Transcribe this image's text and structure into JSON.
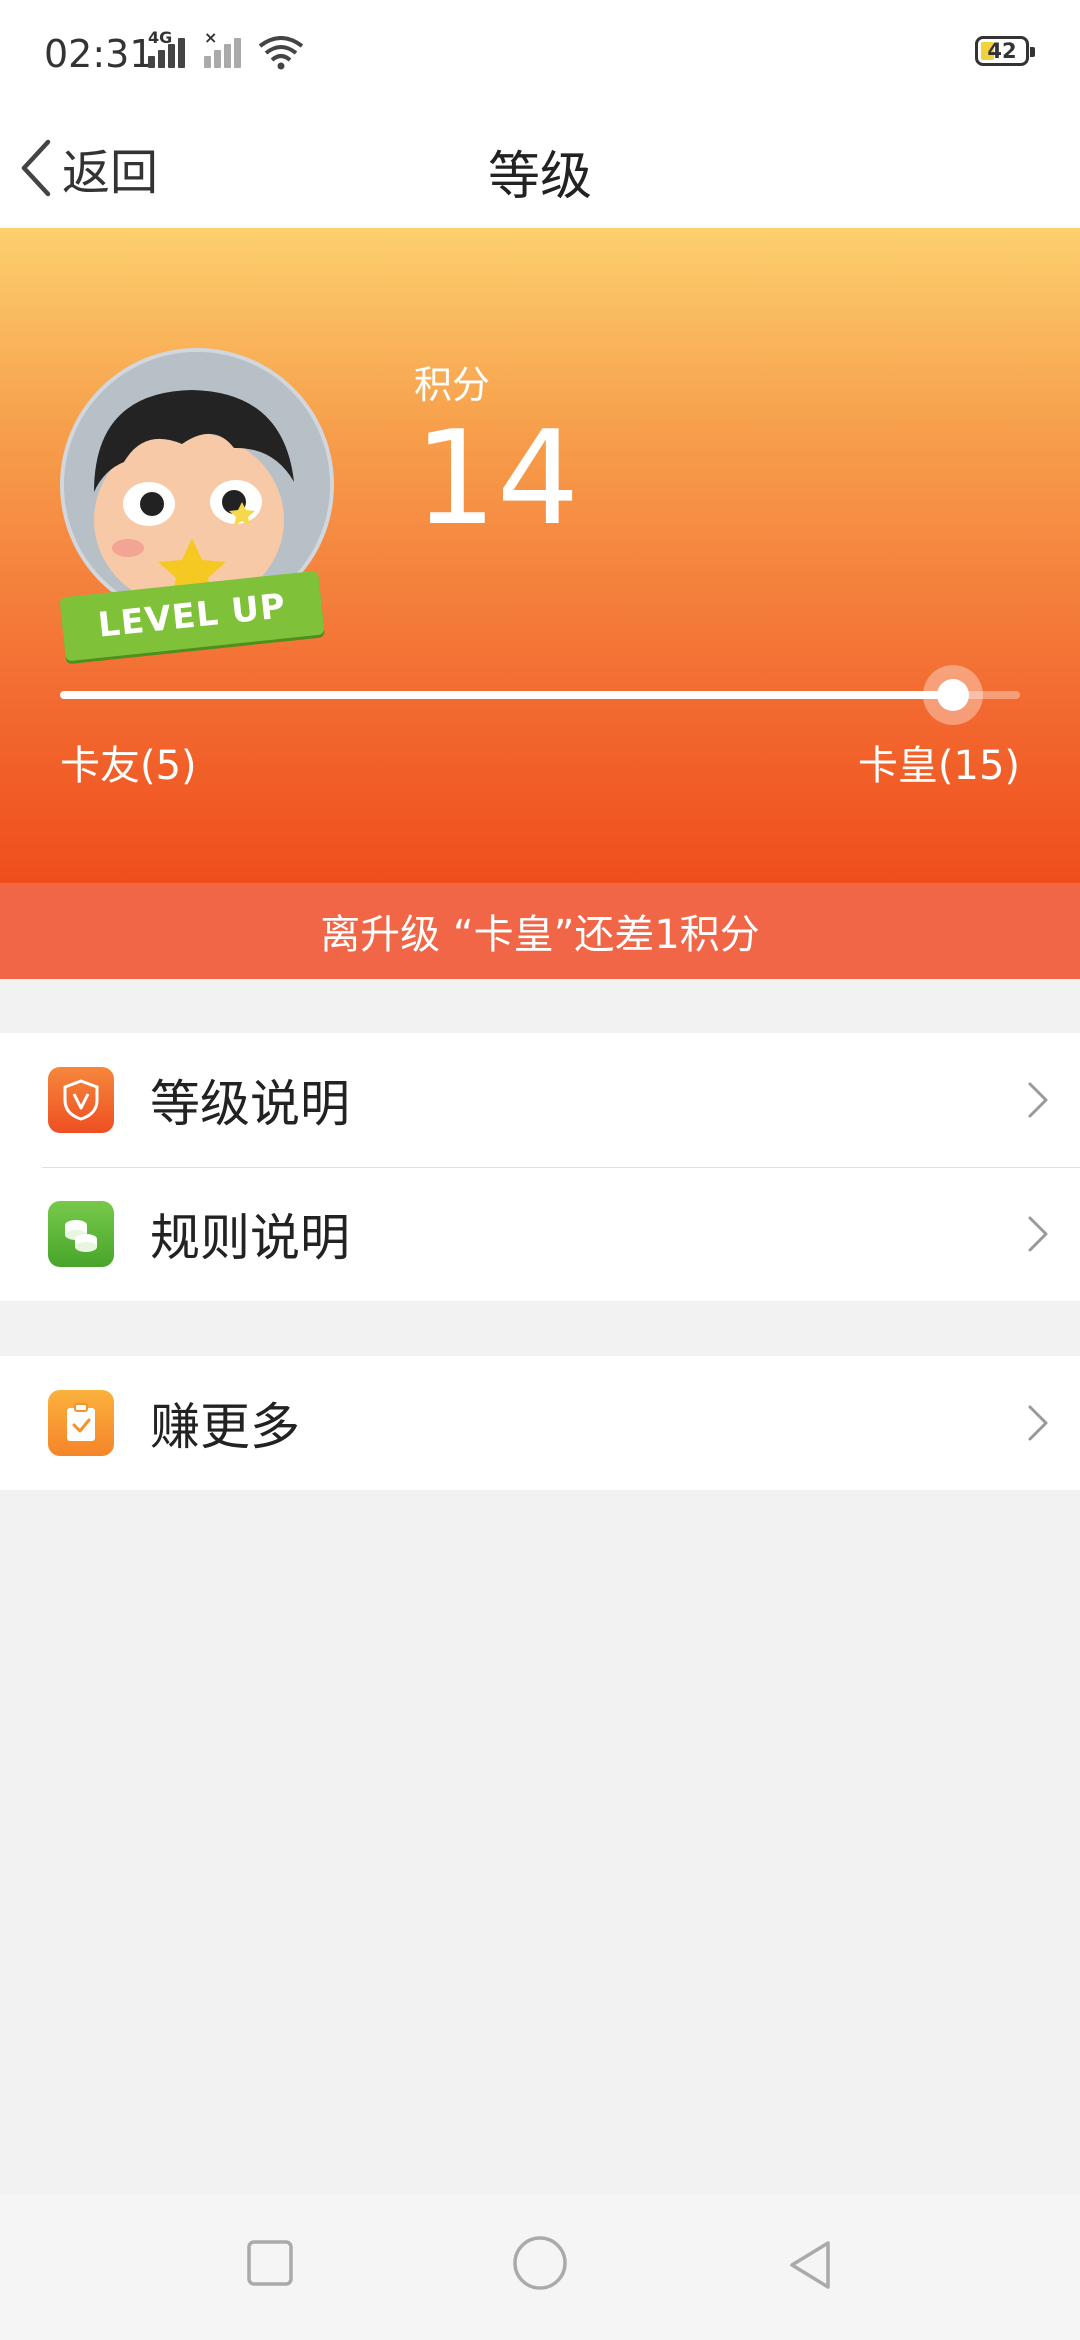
{
  "status_bar": {
    "time": "02:31",
    "network_1": "4G",
    "network_2": "×",
    "battery": "42"
  },
  "nav": {
    "back_label": "返回",
    "title": "等级"
  },
  "hero": {
    "badge_text": "LEVEL UP",
    "points_label": "积分",
    "points_value": "14",
    "level_left": "卡友(5)",
    "level_right": "卡皇(15)",
    "progress_fraction": 0.93,
    "upgrade_hint": "离升级 “卡皇”还差1积分"
  },
  "menu": {
    "group1": [
      {
        "label": "等级说明",
        "icon": "shield-v-icon"
      },
      {
        "label": "规则说明",
        "icon": "coins-icon"
      }
    ],
    "group2": [
      {
        "label": "赚更多",
        "icon": "clipboard-check-icon"
      }
    ]
  },
  "colors": {
    "accent_orange": "#f36d33",
    "hint_bar": "#f06647",
    "icon_green": "#5fb536",
    "icon_orange": "#f5922a"
  }
}
